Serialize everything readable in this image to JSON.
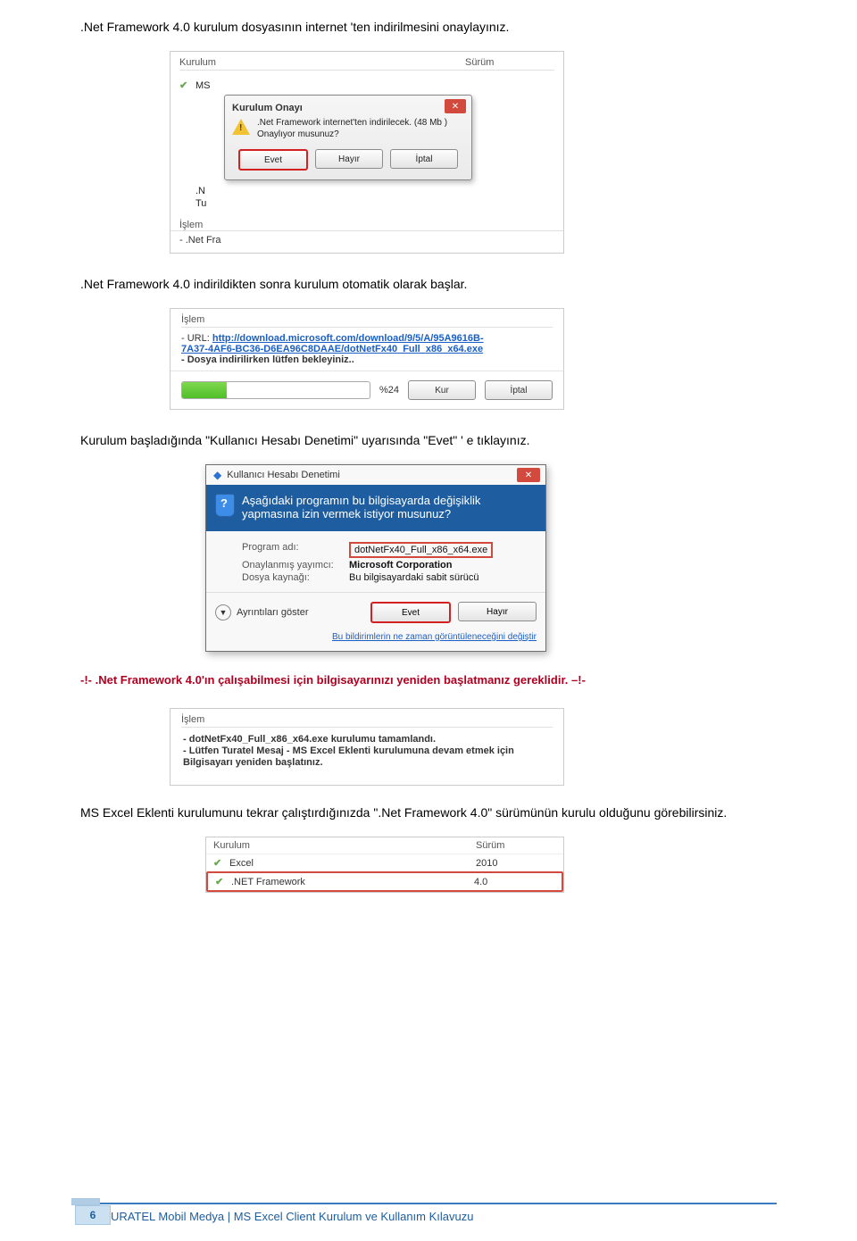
{
  "para1": ".Net Framework 4.0 kurulum dosyasının internet 'ten indirilmesini onaylayınız.",
  "shot1": {
    "col_kurulum": "Kurulum",
    "col_surum": "Sürüm",
    "row_ms": "MS",
    "row_n": ".N",
    "row_tu": "Tu",
    "islem_label": "İşlem",
    "islem_text": "- .Net Fra",
    "dlg_title": "Kurulum Onayı",
    "dlg_line1": ".Net Framework internet'ten indirilecek. (48 Mb )",
    "dlg_line2": "Onaylıyor musunuz?",
    "btn_evet": "Evet",
    "btn_hayir": "Hayır",
    "btn_iptal": "İptal"
  },
  "para2": ".Net Framework 4.0 indirildikten sonra kurulum otomatik olarak başlar.",
  "shot2": {
    "islem_label": "İşlem",
    "url_label": "- URL: ",
    "url1": "http://download.microsoft.com/download/9/5/A/95A9616B-",
    "url2": "7A37-4AF6-BC36-D6EA96C8DAAE/dotNetFx40_Full_x86_x64.exe",
    "wait": "- Dosya indirilirken lütfen bekleyiniz..",
    "pct": "%24",
    "btn_kur": "Kur",
    "btn_iptal": "İptal"
  },
  "para3": "Kurulum başladığında \"Kullanıcı Hesabı Denetimi\" uyarısında \"Evet\" ' e  tıklayınız.",
  "shot3": {
    "title": "Kullanıcı Hesabı Denetimi",
    "band": "Aşağıdaki programın bu bilgisayarda değişiklik yapmasına izin vermek istiyor musunuz?",
    "prog_adi_lbl": "Program adı:",
    "prog_adi_val": "dotNetFx40_Full_x86_x64.exe",
    "yayin_lbl": "Onaylanmış yayımcı:",
    "yayin_val": "Microsoft Corporation",
    "dosya_lbl": "Dosya kaynağı:",
    "dosya_val": "Bu bilgisayardaki sabit sürücü",
    "ayrinti": "Ayrıntıları göster",
    "btn_evet": "Evet",
    "btn_hayir": "Hayır",
    "link": "Bu bildirimlerin ne zaman görüntüleneceğini değiştir"
  },
  "warn": "-!- .Net Framework 4.0'ın çalışabilmesi için bilgisayarınızı yeniden başlatmanız gereklidir. –!-",
  "shot4": {
    "islem_label": "İşlem",
    "l1": "- dotNetFx40_Full_x86_x64.exe kurulumu tamamlandı.",
    "l2": "- Lütfen Turatel Mesaj - MS Excel Eklenti kurulumuna devam etmek için",
    "l3": "Bilgisayarı yeniden başlatınız."
  },
  "para4": "MS Excel Eklenti kurulumunu tekrar çalıştırdığınızda \".Net Framework 4.0\" sürümünün kurulu olduğunu görebilirsiniz.",
  "shot5": {
    "col_kurulum": "Kurulum",
    "col_surum": "Sürüm",
    "r1_name": "Excel",
    "r1_ver": "2010",
    "r2_name": ".NET Framework",
    "r2_ver": "4.0"
  },
  "footer": {
    "text": "TURATEL Mobil Medya | MS Excel Client Kurulum ve Kullanım Kılavuzu",
    "page": "6"
  }
}
